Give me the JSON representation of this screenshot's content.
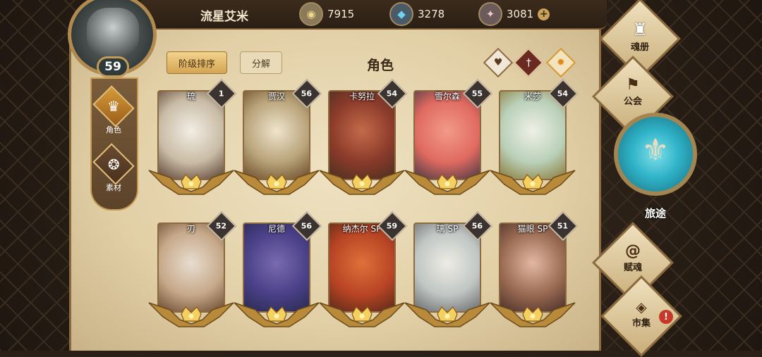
{
  "header": {
    "player_name": "流星艾米",
    "player_level": "59",
    "gold": "7915",
    "crystal": "3278",
    "gem": "3081",
    "add_label": "+"
  },
  "left_tabs": [
    {
      "label": "角色",
      "icon": "helmet-icon",
      "active": true
    },
    {
      "label": "素材",
      "icon": "beast-icon",
      "active": false
    }
  ],
  "toolbar": {
    "sort_label": "阶级排序",
    "dismantle_label": "分解",
    "title": "角色"
  },
  "filters": [
    {
      "icon": "heart-icon",
      "glyph": "♥"
    },
    {
      "icon": "sword-icon",
      "glyph": "†"
    },
    {
      "icon": "sun-icon",
      "glyph": "✹"
    }
  ],
  "characters": [
    {
      "name": "琉",
      "level": "1",
      "palette": [
        "#f2ede3",
        "#c9bca6",
        "#5a4030"
      ]
    },
    {
      "name": "贾汉",
      "level": "56",
      "palette": [
        "#efe4cc",
        "#b8a37a",
        "#6b4b28"
      ]
    },
    {
      "name": "卡努拉",
      "level": "54",
      "palette": [
        "#c46a4a",
        "#8a3a2a",
        "#4a3020"
      ]
    },
    {
      "name": "雪尔森",
      "level": "55",
      "palette": [
        "#f29a8a",
        "#e06a60",
        "#4a3a44"
      ]
    },
    {
      "name": "米莎",
      "level": "54",
      "palette": [
        "#eff0e6",
        "#b9d0b8",
        "#8a7a3a"
      ]
    },
    {
      "name": "刃",
      "level": "52",
      "palette": [
        "#e8ddd0",
        "#c7a98a",
        "#6a4a30"
      ]
    },
    {
      "name": "尼德",
      "level": "56",
      "palette": [
        "#7a6ab0",
        "#4a4088",
        "#2a2a50"
      ]
    },
    {
      "name": "纳杰尔 SP",
      "level": "59",
      "palette": [
        "#e0703a",
        "#b84424",
        "#5a2a1a"
      ]
    },
    {
      "name": "璃 SP",
      "level": "56",
      "palette": [
        "#eeece4",
        "#c0c6c4",
        "#6a6a6a"
      ]
    },
    {
      "name": "猫眼 SP",
      "level": "51",
      "palette": [
        "#e2b8a2",
        "#9a6a52",
        "#4a302a"
      ]
    }
  ],
  "right_nav": [
    {
      "label": "魂册",
      "icon": "book-helmet-icon"
    },
    {
      "label": "公会",
      "icon": "guild-icon"
    },
    {
      "label": "旅途",
      "icon": "journey-emblem-icon"
    },
    {
      "label": "赋魂",
      "icon": "spiral-icon"
    },
    {
      "label": "市集",
      "icon": "gem-market-icon",
      "alert": "!"
    }
  ],
  "colors": {
    "accent_gold": "#d3a554",
    "alert_red": "#c8382a",
    "journey_teal": "#2fb3c8"
  }
}
